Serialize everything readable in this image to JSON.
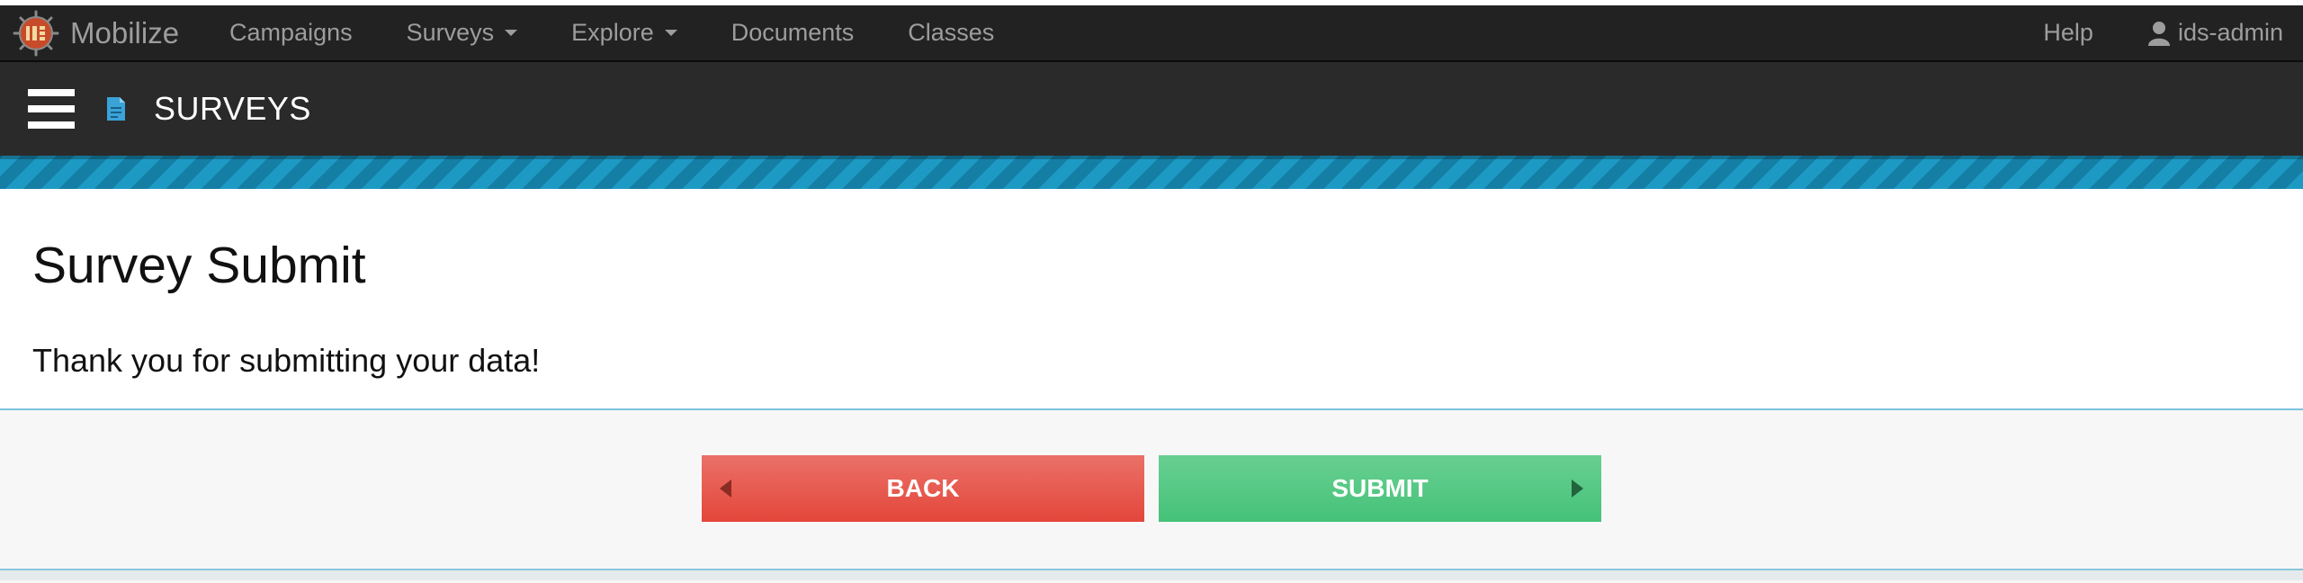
{
  "navbar": {
    "brand": "Mobilize",
    "items": [
      {
        "label": "Campaigns",
        "dropdown": false
      },
      {
        "label": "Surveys",
        "dropdown": true
      },
      {
        "label": "Explore",
        "dropdown": true
      },
      {
        "label": "Documents",
        "dropdown": false
      },
      {
        "label": "Classes",
        "dropdown": false
      }
    ],
    "help": "Help",
    "user": "ids-admin"
  },
  "subbar": {
    "title": "SURVEYS",
    "menu_icon": "hamburger-icon",
    "section_icon": "document-icon"
  },
  "main": {
    "title": "Survey Submit",
    "message": "Thank you for submitting your data!"
  },
  "actions": {
    "back_label": "BACK",
    "submit_label": "SUBMIT"
  },
  "colors": {
    "navbar": "#222222",
    "accent_blue": "#1d9ac4",
    "back_button": "#e4463a",
    "submit_button": "#45c279"
  }
}
